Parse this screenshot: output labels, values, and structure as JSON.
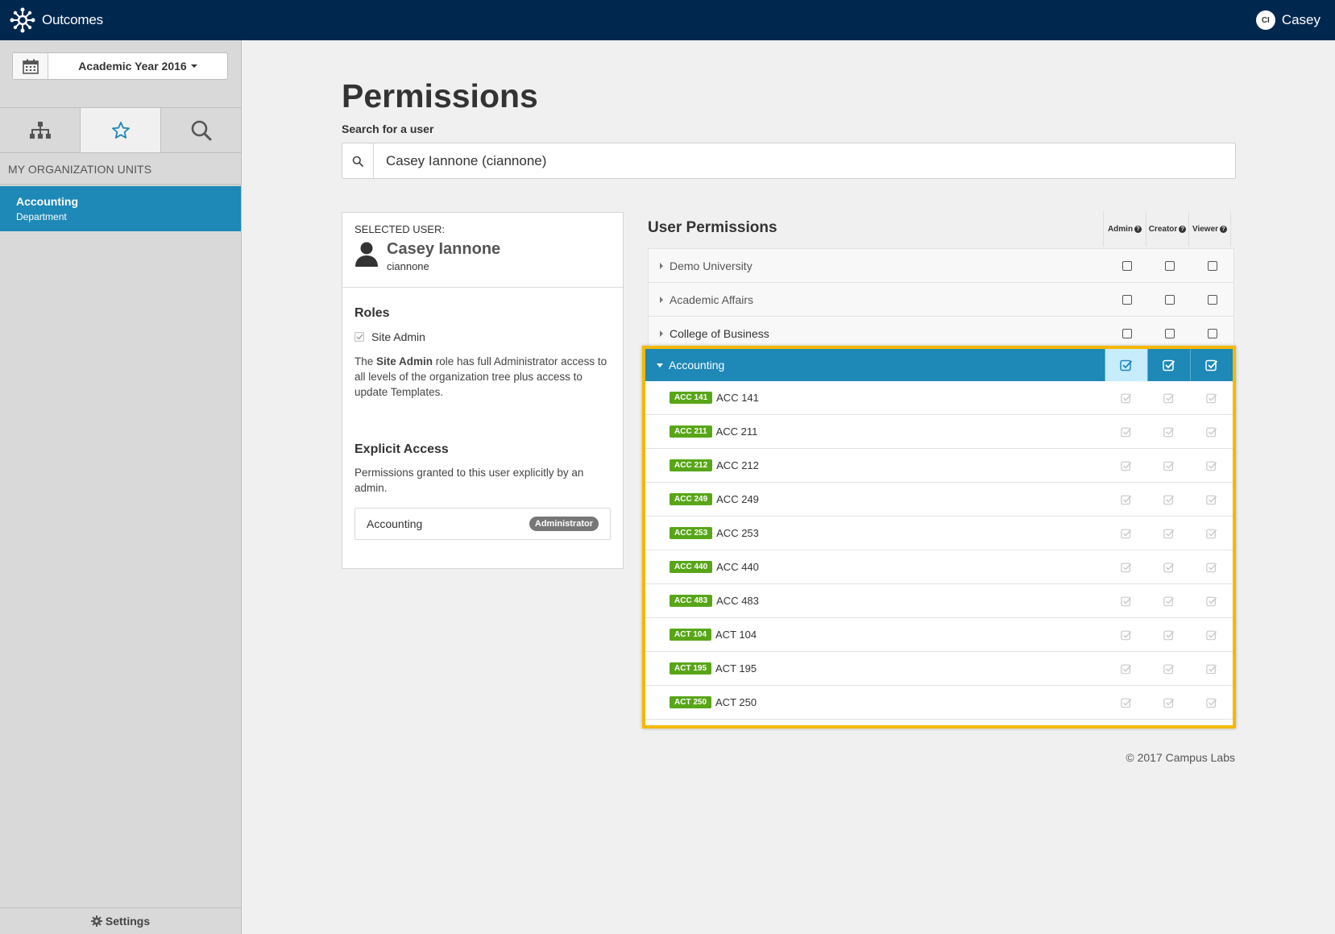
{
  "topbar": {
    "app_name": "Outcomes",
    "user_initials": "CI",
    "user_name": "Casey"
  },
  "sidebar": {
    "year_label": "Academic Year 2016",
    "tabs": [
      {
        "icon": "hierarchy-icon"
      },
      {
        "icon": "star-icon",
        "active": true
      },
      {
        "icon": "search-icon"
      }
    ],
    "heading": "MY ORGANIZATION UNITS",
    "items": [
      {
        "name": "Accounting",
        "type": "Department"
      }
    ],
    "settings_label": "Settings"
  },
  "main": {
    "title": "Permissions",
    "search_label": "Search for a user",
    "search_value": "Casey Iannone (ciannone)"
  },
  "selected_user": {
    "label": "SELECTED USER:",
    "name": "Casey Iannone",
    "login": "ciannone",
    "roles_title": "Roles",
    "role_name": "Site Admin",
    "role_desc_prefix": "The ",
    "role_desc_bold": "Site Admin",
    "role_desc_suffix": " role has full Administrator access to all levels of the organization tree plus access to update Templates.",
    "explicit_title": "Explicit Access",
    "explicit_desc": "Permissions granted to this user explicitly by an admin.",
    "access_unit": "Accounting",
    "access_role": "Administrator"
  },
  "permissions": {
    "title": "User Permissions",
    "columns": [
      "Admin",
      "Creator",
      "Viewer"
    ],
    "units": [
      {
        "label": "Demo University"
      },
      {
        "label": "Academic Affairs"
      },
      {
        "label": "College of Business"
      }
    ],
    "expanded_unit": "Accounting",
    "courses": [
      {
        "code": "ACC 141",
        "name": "ACC 141"
      },
      {
        "code": "ACC 211",
        "name": "ACC 211"
      },
      {
        "code": "ACC 212",
        "name": "ACC 212"
      },
      {
        "code": "ACC 249",
        "name": "ACC 249"
      },
      {
        "code": "ACC 253",
        "name": "ACC 253"
      },
      {
        "code": "ACC 440",
        "name": "ACC 440"
      },
      {
        "code": "ACC 483",
        "name": "ACC 483"
      },
      {
        "code": "ACT 104",
        "name": "ACT 104"
      },
      {
        "code": "ACT 195",
        "name": "ACT 195"
      },
      {
        "code": "ACT 250",
        "name": "ACT 250"
      }
    ]
  },
  "footer": "© 2017 Campus Labs",
  "colors": {
    "topbar": "#00284f",
    "accent": "#1e88b7",
    "highlight_border": "#f5b800",
    "course_tag": "#58a618"
  }
}
